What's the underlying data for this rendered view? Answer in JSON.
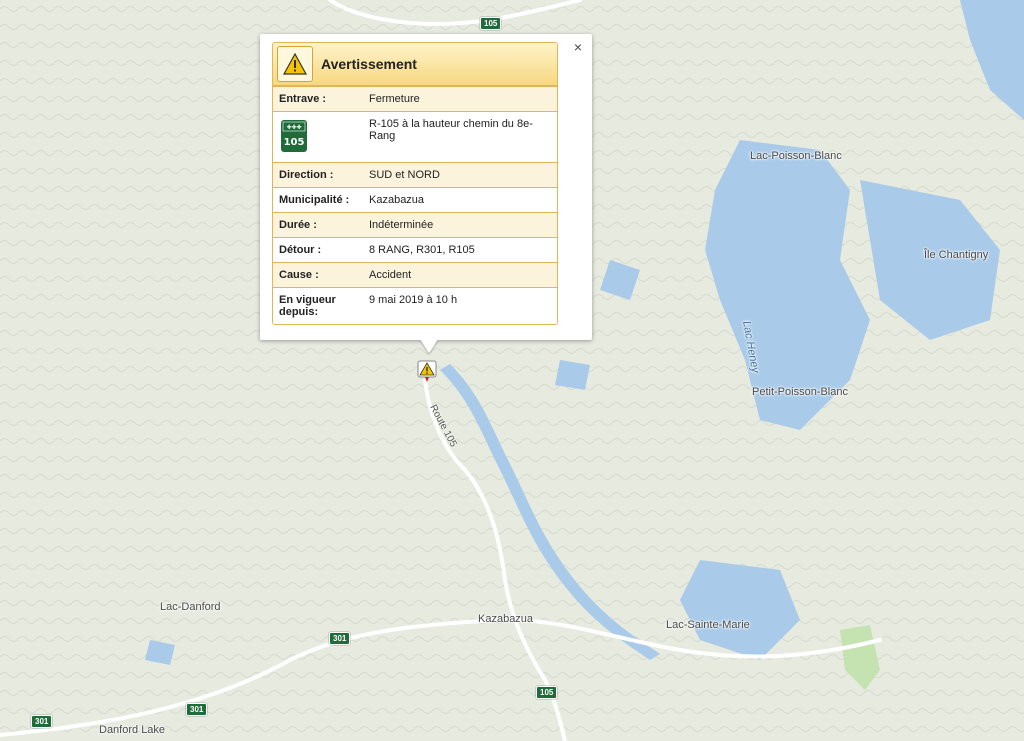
{
  "popup": {
    "title": "Avertissement",
    "close_symbol": "×",
    "icon": "warning-triangle-icon",
    "route_sign": {
      "top_text": "✚✚✚",
      "number": "105",
      "color": "#1f6b3a"
    },
    "rows": [
      {
        "label": "Entrave :",
        "value": "Fermeture"
      },
      {
        "label": "",
        "value": "R-105 à la hauteur chemin du 8e-Rang"
      },
      {
        "label": "Direction :",
        "value": "SUD et NORD"
      },
      {
        "label": "Municipalité :",
        "value": "Kazabazua"
      },
      {
        "label": "Durée :",
        "value": "Indéterminée"
      },
      {
        "label": "Détour :",
        "value": "8 RANG, R301, R105"
      },
      {
        "label": "Cause :",
        "value": "Accident"
      },
      {
        "label": "En vigueur depuis:",
        "value": "9 mai 2019 à 10 h"
      }
    ]
  },
  "map": {
    "places": [
      {
        "name": "Lac-Poisson-Blanc"
      },
      {
        "name": "Île Chantigny"
      },
      {
        "name": "Lac Heney"
      },
      {
        "name": "Petit-Poisson-Blanc"
      },
      {
        "name": "Kazabazua"
      },
      {
        "name": "Lac-Sainte-Marie"
      },
      {
        "name": "Lac-Danford"
      },
      {
        "name": "Danford Lake"
      }
    ],
    "road_label": "Route 105",
    "shields": [
      "105",
      "105",
      "301",
      "301",
      "301"
    ],
    "colors": {
      "land": "#e6eadf",
      "water": "#a9cbe9",
      "road": "#ffffff",
      "park": "#c5e3b0",
      "accent": "#f6d881"
    }
  }
}
